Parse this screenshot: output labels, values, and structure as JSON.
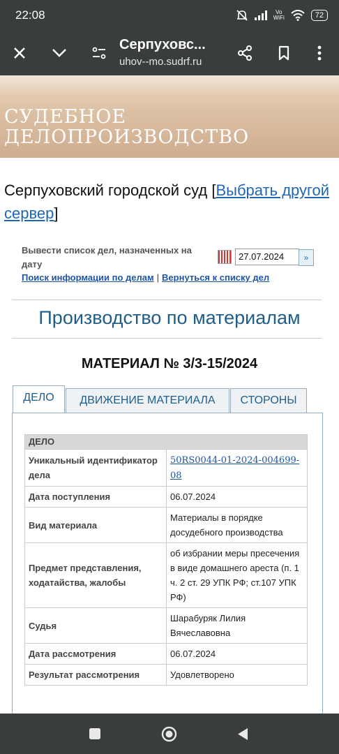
{
  "status_bar": {
    "time": "22:08",
    "vowifi_top": "Vo",
    "vowifi_bottom": "WiFi",
    "battery": "72"
  },
  "browser": {
    "title": "Серпуховс...",
    "url": "uhov--mo.sudrf.ru"
  },
  "banner": {
    "line1": "СУДЕБНОЕ",
    "line2": "ДЕЛОПРОИЗВОДСТВО"
  },
  "court": {
    "name": "Серпуховский городской суд [",
    "link": "Выбрать другой сервер",
    "suffix": "]"
  },
  "date_form": {
    "label": "Вывести список дел, назначенных на дату",
    "value": "27.07.2024",
    "go": "»"
  },
  "links": {
    "search": "Поиск информации по делам",
    "separator": "|",
    "back": "Вернуться к списку дел"
  },
  "section_title": "Производство по материалам",
  "material_title": "МАТЕРИАЛ № 3/3-15/2024",
  "tabs": [
    {
      "label": "ДЕЛО"
    },
    {
      "label": "ДВИЖЕНИЕ МАТЕРИАЛА"
    },
    {
      "label": "СТОРОНЫ"
    }
  ],
  "case_table": {
    "header": "ДЕЛО",
    "rows": [
      {
        "label": "Уникальный идентификатор дела",
        "value": "50RS0044-01-2024-004699-08"
      },
      {
        "label": "Дата поступления",
        "value": "06.07.2024"
      },
      {
        "label": "Вид материала",
        "value": "Материалы в порядке досудебного производства"
      },
      {
        "label": "Предмет представления, ходатайства, жалобы",
        "value": "об избрании меры пресечения в виде домашнего ареста (п. 1 ч. 2 ст. 29 УПК РФ; ст.107 УПК РФ)"
      },
      {
        "label": "Судья",
        "value": "Шарабуряк Лилия Вячеславовна"
      },
      {
        "label": "Дата рассмотрения",
        "value": "06.07.2024"
      },
      {
        "label": "Результат рассмотрения",
        "value": "Удовлетворено"
      }
    ]
  },
  "icons": {
    "toolbar": [
      "close-icon",
      "chevron-down-icon",
      "site-settings-icon",
      "share-icon",
      "bookmark-icon",
      "more-vert-icon"
    ],
    "navbar": [
      "recents-square-icon",
      "home-circle-icon",
      "back-triangle-icon"
    ]
  },
  "colors": {
    "system_bar": "#3a3d3e",
    "link": "#1f55a0",
    "section_title": "#1f5e8a",
    "table_header": "#d8d8d8"
  }
}
